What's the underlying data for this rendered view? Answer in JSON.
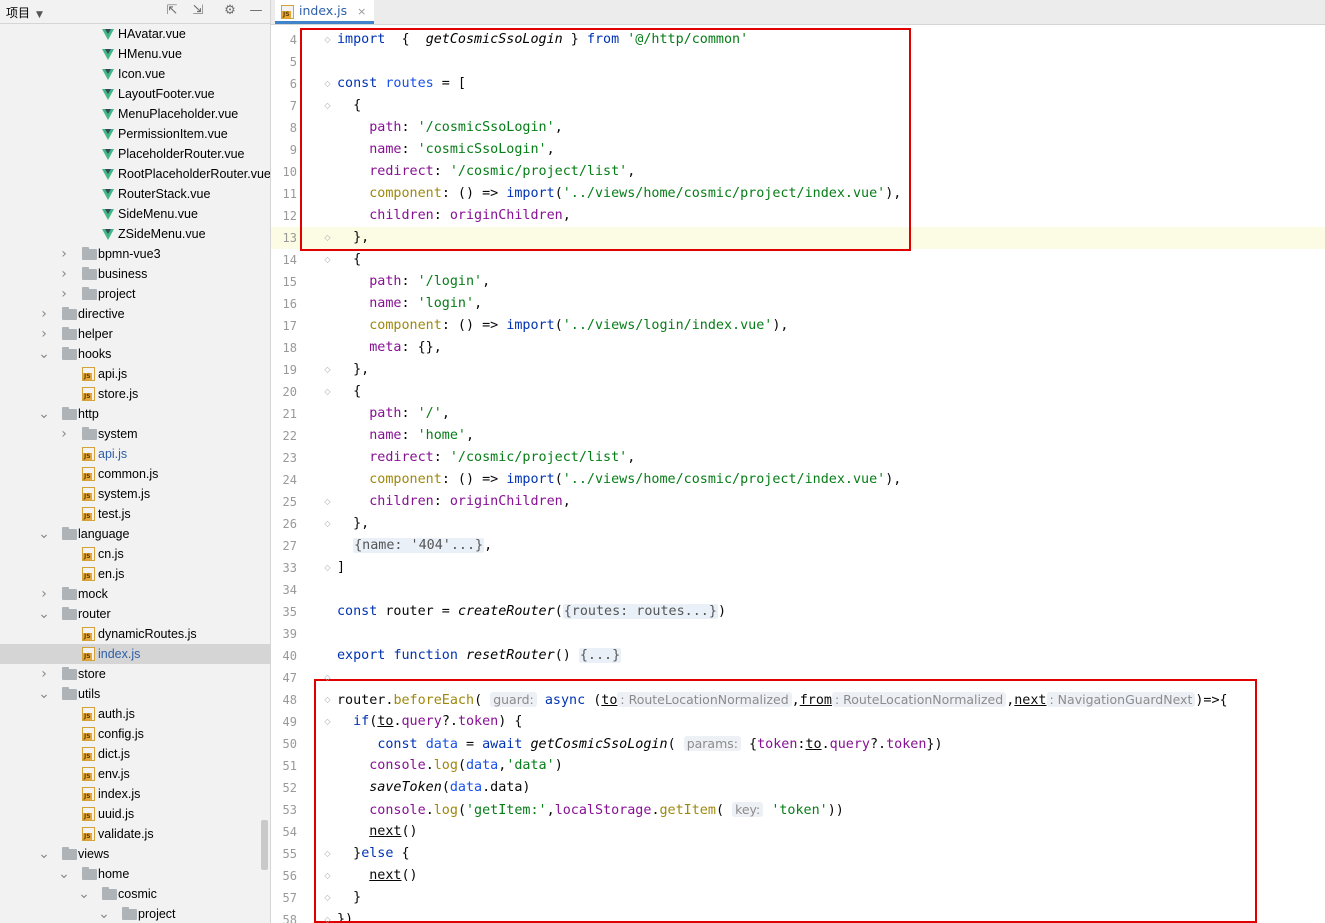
{
  "panel": {
    "title": "项目"
  },
  "tree": [
    {
      "label": "HAvatar.vue",
      "type": "vue",
      "depth": 4
    },
    {
      "label": "HMenu.vue",
      "type": "vue",
      "depth": 4
    },
    {
      "label": "Icon.vue",
      "type": "vue",
      "depth": 4
    },
    {
      "label": "LayoutFooter.vue",
      "type": "vue",
      "depth": 4
    },
    {
      "label": "MenuPlaceholder.vue",
      "type": "vue",
      "depth": 4
    },
    {
      "label": "PermissionItem.vue",
      "type": "vue",
      "depth": 4
    },
    {
      "label": "PlaceholderRouter.vue",
      "type": "vue",
      "depth": 4
    },
    {
      "label": "RootPlaceholderRouter.vue",
      "type": "vue",
      "depth": 4
    },
    {
      "label": "RouterStack.vue",
      "type": "vue",
      "depth": 4
    },
    {
      "label": "SideMenu.vue",
      "type": "vue",
      "depth": 4
    },
    {
      "label": "ZSideMenu.vue",
      "type": "vue",
      "depth": 4
    },
    {
      "label": "bpmn-vue3",
      "type": "folder",
      "depth": 3,
      "state": "collapsed"
    },
    {
      "label": "business",
      "type": "folder",
      "depth": 3,
      "state": "collapsed"
    },
    {
      "label": "project",
      "type": "folder",
      "depth": 3,
      "state": "collapsed"
    },
    {
      "label": "directive",
      "type": "folder",
      "depth": 2,
      "state": "collapsed"
    },
    {
      "label": "helper",
      "type": "folder",
      "depth": 2,
      "state": "collapsed"
    },
    {
      "label": "hooks",
      "type": "folder",
      "depth": 2,
      "state": "expanded"
    },
    {
      "label": "api.js",
      "type": "js",
      "depth": 3
    },
    {
      "label": "store.js",
      "type": "js",
      "depth": 3
    },
    {
      "label": "http",
      "type": "folder",
      "depth": 2,
      "state": "expanded"
    },
    {
      "label": "system",
      "type": "folder",
      "depth": 3,
      "state": "collapsed"
    },
    {
      "label": "api.js",
      "type": "js",
      "depth": 3,
      "modified": true
    },
    {
      "label": "common.js",
      "type": "js",
      "depth": 3
    },
    {
      "label": "system.js",
      "type": "js",
      "depth": 3
    },
    {
      "label": "test.js",
      "type": "js",
      "depth": 3
    },
    {
      "label": "language",
      "type": "folder",
      "depth": 2,
      "state": "expanded"
    },
    {
      "label": "cn.js",
      "type": "js",
      "depth": 3
    },
    {
      "label": "en.js",
      "type": "js",
      "depth": 3
    },
    {
      "label": "mock",
      "type": "folder",
      "depth": 2,
      "state": "collapsed"
    },
    {
      "label": "router",
      "type": "folder",
      "depth": 2,
      "state": "expanded"
    },
    {
      "label": "dynamicRoutes.js",
      "type": "js",
      "depth": 3
    },
    {
      "label": "index.js",
      "type": "js",
      "depth": 3,
      "selected": true,
      "modified": true
    },
    {
      "label": "store",
      "type": "folder",
      "depth": 2,
      "state": "collapsed"
    },
    {
      "label": "utils",
      "type": "folder",
      "depth": 2,
      "state": "expanded"
    },
    {
      "label": "auth.js",
      "type": "js",
      "depth": 3
    },
    {
      "label": "config.js",
      "type": "js",
      "depth": 3
    },
    {
      "label": "dict.js",
      "type": "js",
      "depth": 3
    },
    {
      "label": "env.js",
      "type": "js",
      "depth": 3
    },
    {
      "label": "index.js",
      "type": "js",
      "depth": 3
    },
    {
      "label": "uuid.js",
      "type": "js",
      "depth": 3
    },
    {
      "label": "validate.js",
      "type": "js",
      "depth": 3
    },
    {
      "label": "views",
      "type": "folder",
      "depth": 2,
      "state": "expanded"
    },
    {
      "label": "home",
      "type": "folder",
      "depth": 3,
      "state": "expanded"
    },
    {
      "label": "cosmic",
      "type": "folder",
      "depth": 4,
      "state": "expanded"
    },
    {
      "label": "project",
      "type": "folder",
      "depth": 5,
      "state": "expanded"
    }
  ],
  "tab": {
    "label": "index.js",
    "close": "×"
  },
  "lines": [
    {
      "n": "4",
      "tokens": [
        [
          "kw",
          "import"
        ],
        [
          "",
          "  {  "
        ],
        [
          "fnc",
          "getCosmicSsoLogin"
        ],
        [
          "",
          " } "
        ],
        [
          "kw",
          "from"
        ],
        [
          "",
          " "
        ],
        [
          "str",
          "'@/http/common'"
        ]
      ]
    },
    {
      "n": "5",
      "tokens": []
    },
    {
      "n": "6",
      "tokens": [
        [
          "kw",
          "const"
        ],
        [
          "",
          " "
        ],
        [
          "loc",
          "routes"
        ],
        [
          "",
          " = ["
        ]
      ]
    },
    {
      "n": "7",
      "tokens": [
        [
          "",
          "  {"
        ]
      ]
    },
    {
      "n": "8",
      "tokens": [
        [
          "",
          "    "
        ],
        [
          "prop",
          "path"
        ],
        [
          "",
          ": "
        ],
        [
          "str",
          "'/cosmicSsoLogin'"
        ],
        [
          "",
          ","
        ]
      ]
    },
    {
      "n": "9",
      "tokens": [
        [
          "",
          "    "
        ],
        [
          "prop",
          "name"
        ],
        [
          "",
          ": "
        ],
        [
          "str",
          "'cosmicSsoLogin'"
        ],
        [
          "",
          ","
        ]
      ]
    },
    {
      "n": "10",
      "tokens": [
        [
          "",
          "    "
        ],
        [
          "prop",
          "redirect"
        ],
        [
          "",
          ": "
        ],
        [
          "str",
          "'/cosmic/project/list'"
        ],
        [
          "",
          ","
        ]
      ]
    },
    {
      "n": "11",
      "tokens": [
        [
          "",
          "    "
        ],
        [
          "deco",
          "component"
        ],
        [
          "",
          ": () => "
        ],
        [
          "kw",
          "import"
        ],
        [
          "",
          "("
        ],
        [
          "str",
          "'../views/home/cosmic/project/index.vue'"
        ],
        [
          "",
          "),"
        ]
      ]
    },
    {
      "n": "12",
      "tokens": [
        [
          "",
          "    "
        ],
        [
          "prop",
          "children"
        ],
        [
          "",
          ": "
        ],
        [
          "prop",
          "originChildren"
        ],
        [
          "",
          ","
        ]
      ]
    },
    {
      "n": "13",
      "tokens": [
        [
          "",
          "  },"
        ]
      ],
      "hl": true
    },
    {
      "n": "14",
      "tokens": [
        [
          "",
          "  {"
        ]
      ]
    },
    {
      "n": "15",
      "tokens": [
        [
          "",
          "    "
        ],
        [
          "prop",
          "path"
        ],
        [
          "",
          ": "
        ],
        [
          "str",
          "'/login'"
        ],
        [
          "",
          ","
        ]
      ]
    },
    {
      "n": "16",
      "tokens": [
        [
          "",
          "    "
        ],
        [
          "prop",
          "name"
        ],
        [
          "",
          ": "
        ],
        [
          "str",
          "'login'"
        ],
        [
          "",
          ","
        ]
      ]
    },
    {
      "n": "17",
      "tokens": [
        [
          "",
          "    "
        ],
        [
          "deco",
          "component"
        ],
        [
          "",
          ": () => "
        ],
        [
          "kw",
          "import"
        ],
        [
          "",
          "("
        ],
        [
          "str",
          "'../views/login/index.vue'"
        ],
        [
          "",
          "),"
        ]
      ]
    },
    {
      "n": "18",
      "tokens": [
        [
          "",
          "    "
        ],
        [
          "prop",
          "meta"
        ],
        [
          "",
          ": {},"
        ]
      ]
    },
    {
      "n": "19",
      "tokens": [
        [
          "",
          "  },"
        ]
      ]
    },
    {
      "n": "20",
      "tokens": [
        [
          "",
          "  {"
        ]
      ]
    },
    {
      "n": "21",
      "tokens": [
        [
          "",
          "    "
        ],
        [
          "prop",
          "path"
        ],
        [
          "",
          ": "
        ],
        [
          "str",
          "'/'"
        ],
        [
          "",
          ","
        ]
      ]
    },
    {
      "n": "22",
      "tokens": [
        [
          "",
          "    "
        ],
        [
          "prop",
          "name"
        ],
        [
          "",
          ": "
        ],
        [
          "str",
          "'home'"
        ],
        [
          "",
          ","
        ]
      ]
    },
    {
      "n": "23",
      "tokens": [
        [
          "",
          "    "
        ],
        [
          "prop",
          "redirect"
        ],
        [
          "",
          ": "
        ],
        [
          "str",
          "'/cosmic/project/list'"
        ],
        [
          "",
          ","
        ]
      ]
    },
    {
      "n": "24",
      "tokens": [
        [
          "",
          "    "
        ],
        [
          "deco",
          "component"
        ],
        [
          "",
          ": () => "
        ],
        [
          "kw",
          "import"
        ],
        [
          "",
          "("
        ],
        [
          "str",
          "'../views/home/cosmic/project/index.vue'"
        ],
        [
          "",
          "),"
        ]
      ]
    },
    {
      "n": "25",
      "tokens": [
        [
          "",
          "    "
        ],
        [
          "prop",
          "children"
        ],
        [
          "",
          ": "
        ],
        [
          "prop",
          "originChildren"
        ],
        [
          "",
          ","
        ]
      ]
    },
    {
      "n": "26",
      "tokens": [
        [
          "",
          "  },"
        ]
      ]
    },
    {
      "n": "27",
      "tokens": [
        [
          "",
          "  "
        ],
        [
          "fold",
          "{name: '404'...}"
        ],
        [
          "",
          ","
        ]
      ]
    },
    {
      "n": "33",
      "tokens": [
        [
          "",
          "]"
        ]
      ]
    },
    {
      "n": "34",
      "tokens": []
    },
    {
      "n": "35",
      "tokens": [
        [
          "kw",
          "const"
        ],
        [
          "",
          " router = "
        ],
        [
          "fnc",
          "createRouter"
        ],
        [
          "",
          "("
        ],
        [
          "fold",
          "{routes: routes...}"
        ],
        [
          "",
          ")"
        ]
      ]
    },
    {
      "n": "39",
      "tokens": []
    },
    {
      "n": "40",
      "tokens": [
        [
          "kw",
          "export"
        ],
        [
          "",
          " "
        ],
        [
          "kw",
          "function"
        ],
        [
          "",
          " "
        ],
        [
          "fnc",
          "resetRouter"
        ],
        [
          "",
          "() "
        ],
        [
          "fold",
          "{...}"
        ]
      ]
    },
    {
      "n": "47",
      "tokens": []
    },
    {
      "n": "48",
      "tokens": [
        [
          "",
          "router."
        ],
        [
          "deco",
          "beforeEach"
        ],
        [
          "",
          "( "
        ],
        [
          "hint",
          "guard:"
        ],
        [
          "",
          " "
        ],
        [
          "kw",
          "async"
        ],
        [
          "",
          " ("
        ],
        [
          "ul",
          "to"
        ],
        [
          "hint",
          ": RouteLocationNormalized"
        ],
        [
          "",
          ","
        ],
        [
          "ul",
          "from"
        ],
        [
          "hint",
          ": RouteLocationNormalized"
        ],
        [
          "",
          ","
        ],
        [
          "ul",
          "next"
        ],
        [
          "hint",
          ": NavigationGuardNext"
        ],
        [
          "",
          ")=>{"
        ]
      ]
    },
    {
      "n": "49",
      "tokens": [
        [
          "",
          "  "
        ],
        [
          "kw",
          "if"
        ],
        [
          "",
          "("
        ],
        [
          "ul",
          "to"
        ],
        [
          "",
          "."
        ],
        [
          "prop",
          "query"
        ],
        [
          "",
          "?."
        ],
        [
          "prop",
          "token"
        ],
        [
          "",
          ") {"
        ]
      ]
    },
    {
      "n": "50",
      "tokens": [
        [
          "",
          "     "
        ],
        [
          "kw",
          "const"
        ],
        [
          "",
          " "
        ],
        [
          "loc",
          "data"
        ],
        [
          "",
          " = "
        ],
        [
          "kw",
          "await"
        ],
        [
          "",
          " "
        ],
        [
          "fnc",
          "getCosmicSsoLogin"
        ],
        [
          "",
          "( "
        ],
        [
          "hint",
          "params:"
        ],
        [
          "",
          " {"
        ],
        [
          "prop",
          "token"
        ],
        [
          "",
          ":"
        ],
        [
          "ul",
          "to"
        ],
        [
          "",
          "."
        ],
        [
          "prop",
          "query"
        ],
        [
          "",
          "?."
        ],
        [
          "prop",
          "token"
        ],
        [
          "",
          "})"
        ]
      ]
    },
    {
      "n": "51",
      "tokens": [
        [
          "",
          "    "
        ],
        [
          "prop",
          "console"
        ],
        [
          "",
          "."
        ],
        [
          "deco",
          "log"
        ],
        [
          "",
          "("
        ],
        [
          "loc",
          "data"
        ],
        [
          "",
          ","
        ],
        [
          "str",
          "'data'"
        ],
        [
          "",
          ")"
        ]
      ]
    },
    {
      "n": "52",
      "tokens": [
        [
          "",
          "    "
        ],
        [
          "fnc",
          "saveToken"
        ],
        [
          "",
          "("
        ],
        [
          "loc",
          "data"
        ],
        [
          "",
          ".data)"
        ]
      ]
    },
    {
      "n": "53",
      "tokens": [
        [
          "",
          "    "
        ],
        [
          "prop",
          "console"
        ],
        [
          "",
          "."
        ],
        [
          "deco",
          "log"
        ],
        [
          "",
          "("
        ],
        [
          "str",
          "'getItem:'"
        ],
        [
          "",
          ","
        ],
        [
          "prop",
          "localStorage"
        ],
        [
          "",
          "."
        ],
        [
          "deco",
          "getItem"
        ],
        [
          "",
          "( "
        ],
        [
          "hint",
          "key:"
        ],
        [
          "",
          " "
        ],
        [
          "str",
          "'token'"
        ],
        [
          "",
          "))"
        ]
      ]
    },
    {
      "n": "54",
      "tokens": [
        [
          "",
          "    "
        ],
        [
          "ul",
          "next"
        ],
        [
          "",
          "()"
        ]
      ]
    },
    {
      "n": "55",
      "tokens": [
        [
          "",
          "  }"
        ],
        [
          "kw",
          "else"
        ],
        [
          "",
          " {"
        ]
      ]
    },
    {
      "n": "56",
      "tokens": [
        [
          "",
          "    "
        ],
        [
          "ul",
          "next"
        ],
        [
          "",
          "()"
        ]
      ]
    },
    {
      "n": "57",
      "tokens": [
        [
          "",
          "  }"
        ]
      ]
    },
    {
      "n": "58",
      "tokens": [
        [
          "",
          "})"
        ]
      ]
    }
  ]
}
